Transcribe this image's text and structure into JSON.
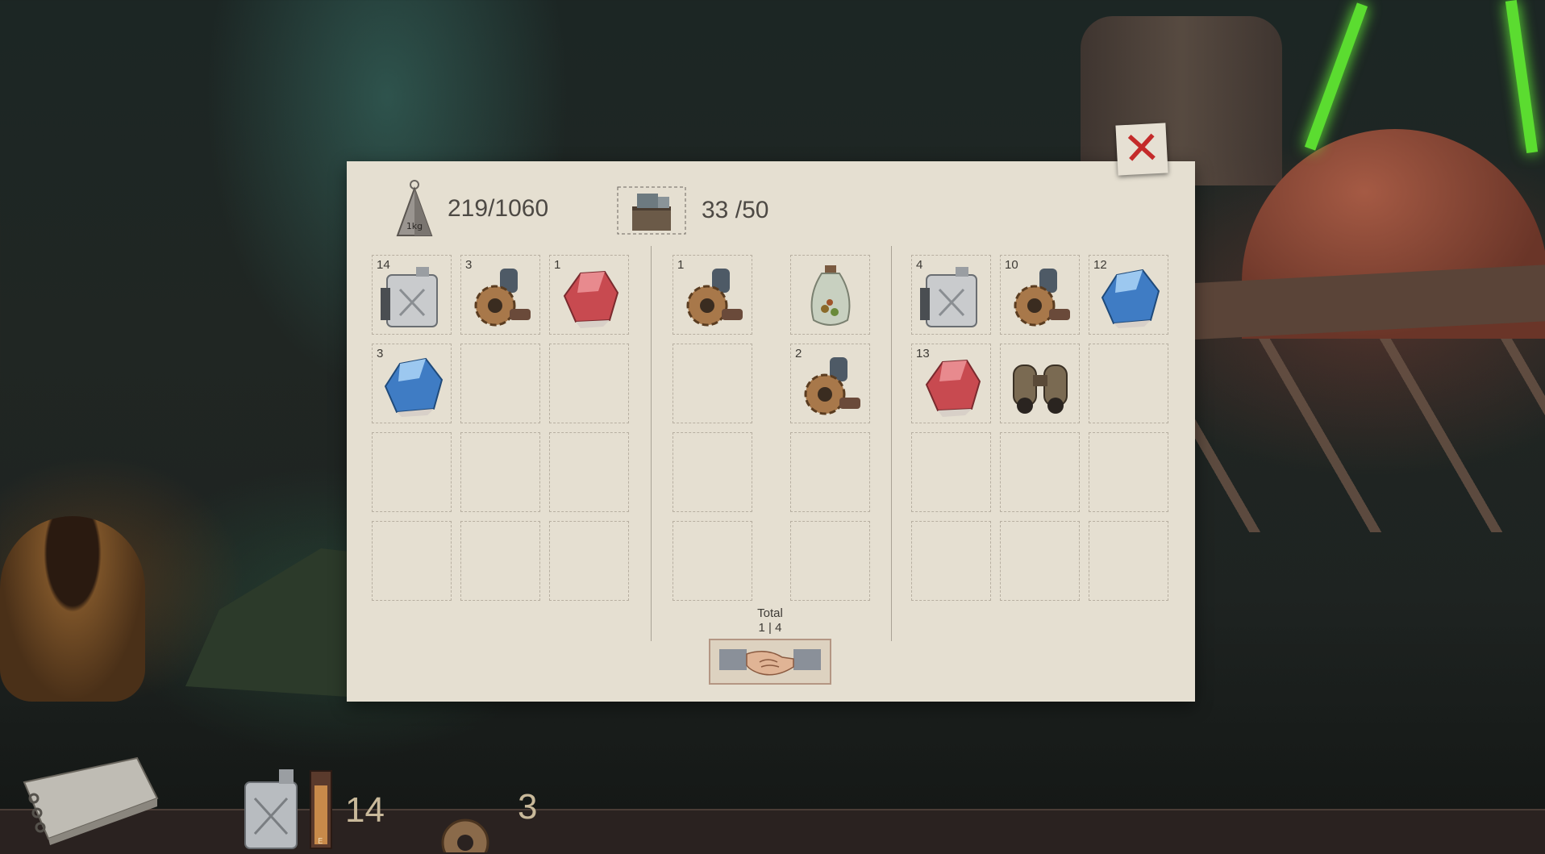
{
  "player_weight": {
    "current": "219",
    "max": "1060",
    "separator": "/",
    "icon": "weight-icon",
    "icon_text": "1kg"
  },
  "storage_capacity": {
    "current": "33",
    "max": "50",
    "separator": "/",
    "icon": "crate-icon"
  },
  "player_inventory": [
    {
      "count": "14",
      "item": "fuel-canister"
    },
    {
      "count": "3",
      "item": "gear-parts"
    },
    {
      "count": "1",
      "item": "red-crystal"
    },
    {
      "count": "3",
      "item": "blue-crystal"
    },
    {
      "count": "",
      "item": ""
    },
    {
      "count": "",
      "item": ""
    },
    {
      "count": "",
      "item": ""
    },
    {
      "count": "",
      "item": ""
    },
    {
      "count": "",
      "item": ""
    },
    {
      "count": "",
      "item": ""
    },
    {
      "count": "",
      "item": ""
    },
    {
      "count": "",
      "item": ""
    }
  ],
  "trade_offer": [
    {
      "count": "1",
      "item": "gear-parts"
    },
    {
      "count": "",
      "item": "seed-jar"
    },
    {
      "count": "",
      "item": ""
    },
    {
      "count": "2",
      "item": "gear-parts"
    },
    {
      "count": "",
      "item": ""
    },
    {
      "count": "",
      "item": ""
    },
    {
      "count": "",
      "item": ""
    },
    {
      "count": "",
      "item": ""
    }
  ],
  "trader_inventory": [
    {
      "count": "4",
      "item": "fuel-canister"
    },
    {
      "count": "10",
      "item": "gear-parts"
    },
    {
      "count": "12",
      "item": "blue-crystal"
    },
    {
      "count": "13",
      "item": "red-crystal"
    },
    {
      "count": "",
      "item": "binoculars"
    },
    {
      "count": "",
      "item": ""
    },
    {
      "count": "",
      "item": ""
    },
    {
      "count": "",
      "item": ""
    },
    {
      "count": "",
      "item": ""
    },
    {
      "count": "",
      "item": ""
    },
    {
      "count": "",
      "item": ""
    },
    {
      "count": "",
      "item": ""
    }
  ],
  "total": {
    "label": "Total",
    "left": "1",
    "separator": "|",
    "right": "4"
  },
  "trade_button": {
    "icon": "handshake-icon"
  },
  "close_button": {
    "icon": "close-icon"
  },
  "hud": {
    "fuel_count": "14",
    "fuel_gauge_level": 0.85,
    "fuel_gauge_label": "E",
    "gear_count": "3",
    "journal_icon": "journal-icon"
  },
  "colors": {
    "panel": "#e5dfd1",
    "close_x": "#c42a2a",
    "hud_text": "#c9b99a"
  }
}
